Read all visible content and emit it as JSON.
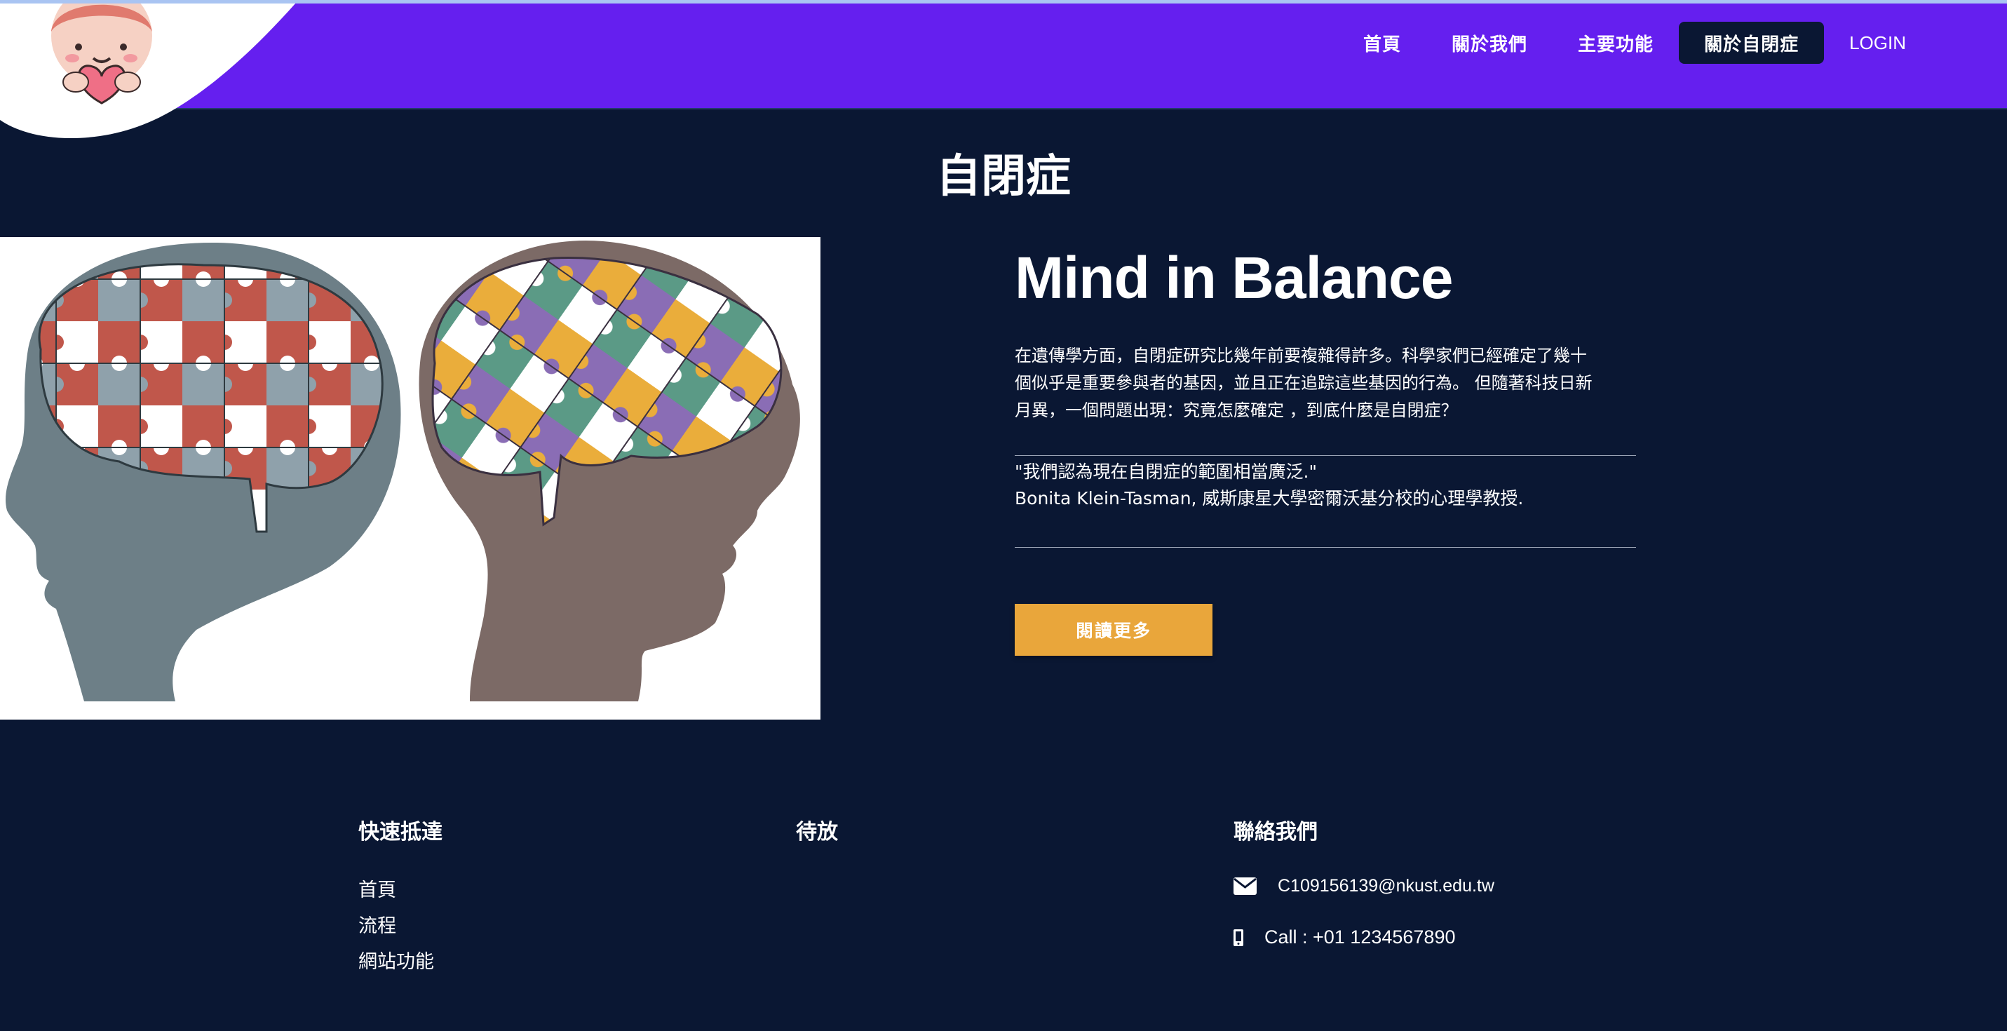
{
  "nav": {
    "items": [
      {
        "label": "首頁",
        "active": false
      },
      {
        "label": "關於我們",
        "active": false
      },
      {
        "label": "主要功能",
        "active": false
      },
      {
        "label": "關於自閉症",
        "active": true
      }
    ],
    "login_label": "LOGIN",
    "logo_icon": "heart-mascot-icon"
  },
  "page": {
    "title": "自閉症"
  },
  "main": {
    "illustration_icon": "puzzle-brain-heads-illustration",
    "headline": "Mind in Balance",
    "paragraph_lines": [
      "在遺傳學方面，自閉症研究比幾年前要複雜得許多。科學家們已經確定了幾十",
      "個似乎是重要參與者的基因，並且正在追踪這些基因的行為。 但隨著科技日新",
      "月異，一個問題出現：究竟怎麼確定 ，到底什麼是自閉症？"
    ],
    "quote": "\"我們認為現在自閉症的範圍相當廣泛.\"",
    "quote_author": "Bonita Klein-Tasman, 威斯康星大學密爾沃基分校的心理學教授.",
    "read_more_label": "閱讀更多"
  },
  "footer": {
    "quick_links": {
      "heading": "快速抵達",
      "links": [
        "首頁",
        "流程",
        "網站功能"
      ]
    },
    "pending": {
      "heading": "待放"
    },
    "contact": {
      "heading": "聯絡我們",
      "email": "C109156139@nkust.edu.tw",
      "phone": "Call : +01 1234567890",
      "email_icon": "envelope-icon",
      "phone_icon": "mobile-phone-icon"
    }
  },
  "colors": {
    "page_bg": "#0a1733",
    "header_bg": "#651fef",
    "button_accent": "#e9a63b",
    "active_nav_bg": "#0a1733"
  }
}
